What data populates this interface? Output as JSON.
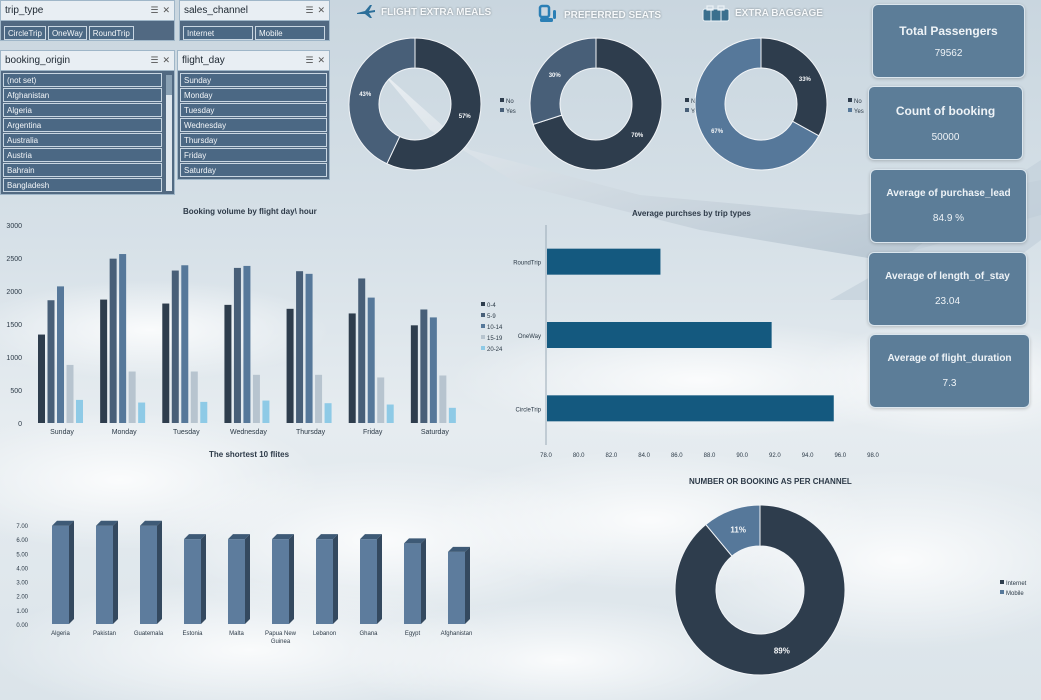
{
  "palette": {
    "dark": "#2e3d4d",
    "mid": "#485f78",
    "blue": "#56789a",
    "light": "#b7c4cf",
    "cyan": "#8ecae6",
    "bar_blue": "#14597f",
    "col_blue": "#5d7c9d"
  },
  "slicers": {
    "trip_type": {
      "title": "trip_type",
      "items": [
        "CircleTrip",
        "OneWay",
        "RoundTrip"
      ]
    },
    "sales_channel": {
      "title": "sales_channel",
      "items": [
        "Internet",
        "Mobile"
      ]
    },
    "booking_origin": {
      "title": "booking_origin",
      "items": [
        "(not set)",
        "Afghanistan",
        "Algeria",
        "Argentina",
        "Australia",
        "Austria",
        "Bahrain",
        "Bangladesh"
      ]
    },
    "flight_day": {
      "title": "flight_day",
      "items": [
        "Sunday",
        "Monday",
        "Tuesday",
        "Wednesday",
        "Thursday",
        "Friday",
        "Saturday"
      ]
    }
  },
  "headers": {
    "meals": {
      "label": "FLIGHT EXTRA MEALS",
      "icon": "plane-meal-icon"
    },
    "seats": {
      "label": "PREFERRED SEATS",
      "icon": "seat-icon"
    },
    "baggage": {
      "label": "EXTRA BAGGAGE",
      "icon": "luggage-icon"
    }
  },
  "kpis": {
    "total_passengers": {
      "title": "Total Passengers",
      "value": "79562"
    },
    "count_booking": {
      "title": "Count of booking",
      "value": "50000"
    },
    "avg_purchase_lead": {
      "title": "Average of purchase_lead",
      "value": "84.9 %"
    },
    "avg_length_of_stay": {
      "title": "Average of length_of_stay",
      "value": "23.04"
    },
    "avg_flight_duration": {
      "title": "Average of flight_duration",
      "value": "7.3"
    }
  },
  "chart_data": [
    {
      "id": "meals",
      "type": "pie",
      "variant": "donut",
      "labels": [
        "No",
        "Yes"
      ],
      "values": [
        57,
        43
      ],
      "value_labels": [
        "57%",
        "43%"
      ],
      "legend_placement": "right",
      "colors": [
        "#2e3d4d",
        "#485f78"
      ]
    },
    {
      "id": "seats",
      "type": "pie",
      "variant": "donut",
      "labels": [
        "No",
        "Yes"
      ],
      "values": [
        70,
        30
      ],
      "value_labels": [
        "70%",
        "30%"
      ],
      "legend_placement": "left",
      "colors": [
        "#2e3d4d",
        "#485f78"
      ]
    },
    {
      "id": "baggage",
      "type": "pie",
      "variant": "donut",
      "labels": [
        "No",
        "Yes"
      ],
      "values": [
        33,
        67
      ],
      "value_labels": [
        "33%",
        "67%"
      ],
      "legend_placement": "right",
      "colors": [
        "#2e3d4d",
        "#56789a"
      ]
    },
    {
      "id": "flight_day_hour",
      "type": "bar",
      "title": "Booking volume by flight day\\ hour",
      "categories": [
        "Sunday",
        "Monday",
        "Tuesday",
        "Wednesday",
        "Thursday",
        "Friday",
        "Saturday"
      ],
      "series": [
        {
          "name": "0-4",
          "values": [
            1340,
            1870,
            1810,
            1790,
            1730,
            1660,
            1480
          ]
        },
        {
          "name": "5-9",
          "values": [
            1860,
            2490,
            2310,
            2350,
            2300,
            2190,
            1720
          ]
        },
        {
          "name": "10-14",
          "values": [
            2070,
            2560,
            2390,
            2380,
            2260,
            1900,
            1600
          ]
        },
        {
          "name": "15-19",
          "values": [
            880,
            780,
            780,
            730,
            730,
            690,
            720
          ]
        },
        {
          "name": "20-24",
          "values": [
            350,
            310,
            320,
            340,
            300,
            280,
            230
          ]
        }
      ],
      "ylim": [
        0,
        3000
      ],
      "yticks": [
        "0",
        "500",
        "1000",
        "1500",
        "2000",
        "2500",
        "3000"
      ],
      "legend_placement": "right"
    },
    {
      "id": "trip_types",
      "type": "bar",
      "orientation": "horizontal",
      "title": "Average purchses by trip types",
      "categories": [
        "RoundTrip",
        "OneWay",
        "CircleTrip"
      ],
      "values": [
        85.0,
        91.8,
        95.6
      ],
      "xlim": [
        78,
        98
      ],
      "xticks": [
        "78.0",
        "80.0",
        "82.0",
        "84.0",
        "86.0",
        "88.0",
        "90.0",
        "92.0",
        "94.0",
        "96.0",
        "98.0"
      ]
    },
    {
      "id": "shortest_flights",
      "type": "bar",
      "variant": "3d-column",
      "title": "The shortest 10 flites",
      "categories": [
        "Algeria",
        "Pakistan",
        "Guatemala",
        "Estonia",
        "Malta",
        "Papua New Guinea",
        "Lebanon",
        "Ghana",
        "Egypt",
        "Afghanistan"
      ],
      "values": [
        6.95,
        6.95,
        6.95,
        6.0,
        6.0,
        6.0,
        6.0,
        6.0,
        5.7,
        5.1
      ],
      "ylim": [
        0,
        7
      ],
      "yticks": [
        "0.00",
        "1.00",
        "2.00",
        "3.00",
        "4.00",
        "5.00",
        "6.00",
        "7.00"
      ]
    },
    {
      "id": "channel",
      "type": "pie",
      "variant": "donut",
      "title": "NUMBER OR BOOKING AS PER CHANNEL",
      "labels": [
        "Internet",
        "Mobile"
      ],
      "values": [
        89,
        11
      ],
      "value_labels": [
        "89%",
        "11%"
      ],
      "legend_placement": "right",
      "colors": [
        "#2e3d4d",
        "#56789a"
      ]
    }
  ]
}
